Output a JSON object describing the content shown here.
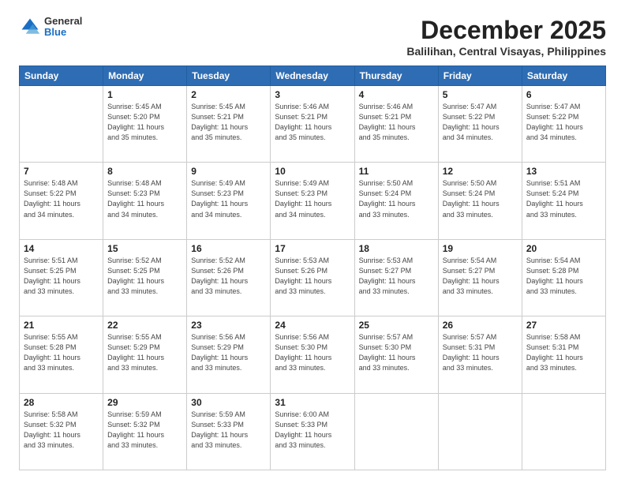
{
  "header": {
    "logo": {
      "general": "General",
      "blue": "Blue"
    },
    "title": "December 2025",
    "location": "Balilihan, Central Visayas, Philippines"
  },
  "days_of_week": [
    "Sunday",
    "Monday",
    "Tuesday",
    "Wednesday",
    "Thursday",
    "Friday",
    "Saturday"
  ],
  "weeks": [
    [
      {
        "day": "",
        "info": ""
      },
      {
        "day": "1",
        "info": "Sunrise: 5:45 AM\nSunset: 5:20 PM\nDaylight: 11 hours\nand 35 minutes."
      },
      {
        "day": "2",
        "info": "Sunrise: 5:45 AM\nSunset: 5:21 PM\nDaylight: 11 hours\nand 35 minutes."
      },
      {
        "day": "3",
        "info": "Sunrise: 5:46 AM\nSunset: 5:21 PM\nDaylight: 11 hours\nand 35 minutes."
      },
      {
        "day": "4",
        "info": "Sunrise: 5:46 AM\nSunset: 5:21 PM\nDaylight: 11 hours\nand 35 minutes."
      },
      {
        "day": "5",
        "info": "Sunrise: 5:47 AM\nSunset: 5:22 PM\nDaylight: 11 hours\nand 34 minutes."
      },
      {
        "day": "6",
        "info": "Sunrise: 5:47 AM\nSunset: 5:22 PM\nDaylight: 11 hours\nand 34 minutes."
      }
    ],
    [
      {
        "day": "7",
        "info": "Sunrise: 5:48 AM\nSunset: 5:22 PM\nDaylight: 11 hours\nand 34 minutes."
      },
      {
        "day": "8",
        "info": "Sunrise: 5:48 AM\nSunset: 5:23 PM\nDaylight: 11 hours\nand 34 minutes."
      },
      {
        "day": "9",
        "info": "Sunrise: 5:49 AM\nSunset: 5:23 PM\nDaylight: 11 hours\nand 34 minutes."
      },
      {
        "day": "10",
        "info": "Sunrise: 5:49 AM\nSunset: 5:23 PM\nDaylight: 11 hours\nand 34 minutes."
      },
      {
        "day": "11",
        "info": "Sunrise: 5:50 AM\nSunset: 5:24 PM\nDaylight: 11 hours\nand 33 minutes."
      },
      {
        "day": "12",
        "info": "Sunrise: 5:50 AM\nSunset: 5:24 PM\nDaylight: 11 hours\nand 33 minutes."
      },
      {
        "day": "13",
        "info": "Sunrise: 5:51 AM\nSunset: 5:24 PM\nDaylight: 11 hours\nand 33 minutes."
      }
    ],
    [
      {
        "day": "14",
        "info": "Sunrise: 5:51 AM\nSunset: 5:25 PM\nDaylight: 11 hours\nand 33 minutes."
      },
      {
        "day": "15",
        "info": "Sunrise: 5:52 AM\nSunset: 5:25 PM\nDaylight: 11 hours\nand 33 minutes."
      },
      {
        "day": "16",
        "info": "Sunrise: 5:52 AM\nSunset: 5:26 PM\nDaylight: 11 hours\nand 33 minutes."
      },
      {
        "day": "17",
        "info": "Sunrise: 5:53 AM\nSunset: 5:26 PM\nDaylight: 11 hours\nand 33 minutes."
      },
      {
        "day": "18",
        "info": "Sunrise: 5:53 AM\nSunset: 5:27 PM\nDaylight: 11 hours\nand 33 minutes."
      },
      {
        "day": "19",
        "info": "Sunrise: 5:54 AM\nSunset: 5:27 PM\nDaylight: 11 hours\nand 33 minutes."
      },
      {
        "day": "20",
        "info": "Sunrise: 5:54 AM\nSunset: 5:28 PM\nDaylight: 11 hours\nand 33 minutes."
      }
    ],
    [
      {
        "day": "21",
        "info": "Sunrise: 5:55 AM\nSunset: 5:28 PM\nDaylight: 11 hours\nand 33 minutes."
      },
      {
        "day": "22",
        "info": "Sunrise: 5:55 AM\nSunset: 5:29 PM\nDaylight: 11 hours\nand 33 minutes."
      },
      {
        "day": "23",
        "info": "Sunrise: 5:56 AM\nSunset: 5:29 PM\nDaylight: 11 hours\nand 33 minutes."
      },
      {
        "day": "24",
        "info": "Sunrise: 5:56 AM\nSunset: 5:30 PM\nDaylight: 11 hours\nand 33 minutes."
      },
      {
        "day": "25",
        "info": "Sunrise: 5:57 AM\nSunset: 5:30 PM\nDaylight: 11 hours\nand 33 minutes."
      },
      {
        "day": "26",
        "info": "Sunrise: 5:57 AM\nSunset: 5:31 PM\nDaylight: 11 hours\nand 33 minutes."
      },
      {
        "day": "27",
        "info": "Sunrise: 5:58 AM\nSunset: 5:31 PM\nDaylight: 11 hours\nand 33 minutes."
      }
    ],
    [
      {
        "day": "28",
        "info": "Sunrise: 5:58 AM\nSunset: 5:32 PM\nDaylight: 11 hours\nand 33 minutes."
      },
      {
        "day": "29",
        "info": "Sunrise: 5:59 AM\nSunset: 5:32 PM\nDaylight: 11 hours\nand 33 minutes."
      },
      {
        "day": "30",
        "info": "Sunrise: 5:59 AM\nSunset: 5:33 PM\nDaylight: 11 hours\nand 33 minutes."
      },
      {
        "day": "31",
        "info": "Sunrise: 6:00 AM\nSunset: 5:33 PM\nDaylight: 11 hours\nand 33 minutes."
      },
      {
        "day": "",
        "info": ""
      },
      {
        "day": "",
        "info": ""
      },
      {
        "day": "",
        "info": ""
      }
    ]
  ]
}
